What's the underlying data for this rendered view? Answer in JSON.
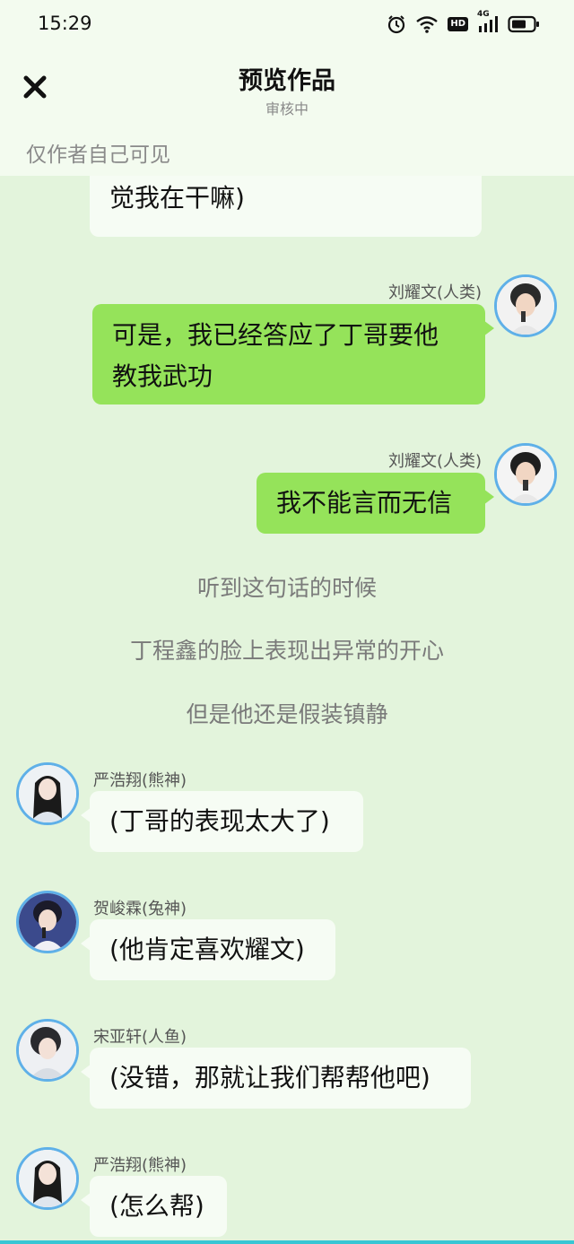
{
  "status_bar": {
    "time": "15:29",
    "icons": [
      "alarm-icon",
      "wifi-icon",
      "hd-badge",
      "cellular-4g-icon",
      "battery-icon"
    ],
    "hd_label": "HD",
    "network_label": "4G"
  },
  "header": {
    "title": "预览作品",
    "status": "审核中",
    "visibility_note": "仅作者自己可见"
  },
  "colors": {
    "background": "#e3f4dc",
    "right_bubble": "#95e35a",
    "left_bubble": "#f6fcf4",
    "avatar_ring": "#5fb0e8"
  },
  "messages": {
    "m0": {
      "text": "觉我在干嘛)"
    },
    "m1": {
      "sender": "刘耀文(人类)",
      "text_line1": "可是，我已经答应了丁哥要他",
      "text_line2": "教我武功"
    },
    "m2": {
      "sender": "刘耀文(人类)",
      "text": "我不能言而无信"
    },
    "narration": [
      "听到这句话的时候",
      "丁程鑫的脸上表现出异常的开心",
      "但是他还是假装镇静"
    ],
    "m3": {
      "sender": "严浩翔(熊神)",
      "text": "(丁哥的表现太大了)"
    },
    "m4": {
      "sender": "贺峻霖(兔神)",
      "text": "(他肯定喜欢耀文)"
    },
    "m5": {
      "sender": "宋亚轩(人鱼)",
      "text": "(没错，那就让我们帮帮他吧)"
    },
    "m6": {
      "sender": "严浩翔(熊神)",
      "text": "(怎么帮)"
    }
  }
}
